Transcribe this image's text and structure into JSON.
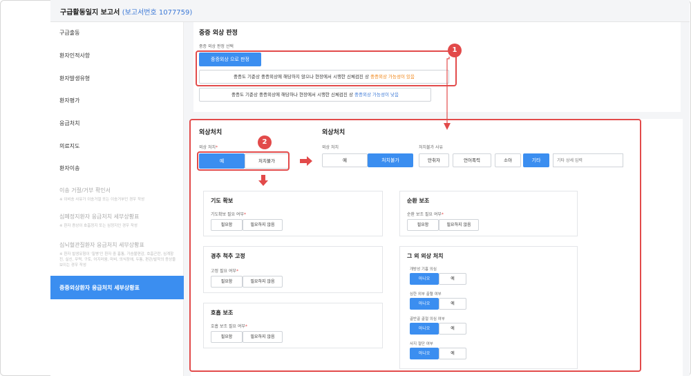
{
  "header": {
    "title": "구급활동일지 보고서",
    "report": "(보고서번호 1077759)"
  },
  "sidebar": {
    "items": [
      {
        "label": "구급출동"
      },
      {
        "label": "환자인적사항"
      },
      {
        "label": "환자발생유형"
      },
      {
        "label": "환자평가"
      },
      {
        "label": "응급처치"
      },
      {
        "label": "의료지도"
      },
      {
        "label": "환자이송"
      },
      {
        "label": "이송 거절/거부 확인서",
        "sub": "※ 이비송 사유가 이송거절 또는 이송거부인 경우 작성"
      },
      {
        "label": "심폐정지환자 응급처치 세부상황표",
        "sub": "※ 환자 증상이 호흡정지 또는 심정지인 경우 작성"
      },
      {
        "label": "심뇌혈관질환자 응급처치 세부상황표",
        "sub": "※ 환자 발생유형이 '질병'인 환자 중 흉통, 가슴불편감, 호흡곤란, 심계항진, 실신, 무력, 구토, 어지러움, 마비, 의식장애, 두통, 편관/발작의 증상을 보이는 경우 작성"
      },
      {
        "label": "중증외상환자 응급처치 세부상황표"
      }
    ]
  },
  "severe": {
    "title": "중증 외상 판정",
    "label": "중증 외상 판정 선택",
    "primary_btn": "중증외상 으로 판정",
    "opt1_prefix": "중증도 기준상 중증외상에 해당하지 않으나 현장에서 시행한 신체검진 상",
    "opt1_highlight": "중증외상 가능성이 있음",
    "opt2_prefix": "중증도 기준상 중증외상에 해당하나 현장에서 시행한 신체검진 상",
    "opt2_highlight": "중증외상 가능성이 낮음"
  },
  "badges": {
    "one": "1",
    "two": "2"
  },
  "trauma_left": {
    "title": "외상처치",
    "label": "외상 처치",
    "req": "*",
    "yes": "예",
    "no": "처치불가"
  },
  "trauma_right": {
    "title": "외상처치",
    "label": "외상 처치",
    "yes": "예",
    "no": "처치불가",
    "reason_label": "처치불가 사유",
    "reasons": [
      "만취자",
      "언어폭력",
      "소아",
      "기타"
    ],
    "detail_placeholder": "기타 상세 입력"
  },
  "cards": {
    "airway": {
      "title": "기도 확보",
      "label": "기도확보 필요 여부",
      "need": "필요함",
      "noneed": "필요하지 않음"
    },
    "spine": {
      "title": "경추 척추 고정",
      "label": "고정 필요 여부",
      "need": "필요함",
      "noneed": "필요하지 않음"
    },
    "breath": {
      "title": "호흡 보조",
      "label": "호흡 보조 필요 여부",
      "need": "필요함",
      "noneed": "필요하지 않음"
    },
    "circ": {
      "title": "순환 보조",
      "label": "순환 보조 필요 여부",
      "need": "필요함",
      "noneed": "필요하지 않음"
    },
    "other": {
      "title": "그 외 외상 처치",
      "rows": [
        {
          "label": "개방성 기흉 의심",
          "no": "아니오",
          "yes": "예"
        },
        {
          "label": "심한 외부 출혈 여부",
          "no": "아니오",
          "yes": "예"
        },
        {
          "label": "골반골 골절 의심 여부",
          "no": "아니오",
          "yes": "예"
        },
        {
          "label": "사지 절단 여부",
          "no": "아니오",
          "yes": "예"
        }
      ]
    }
  },
  "colors": {
    "accent": "#3b8ef0",
    "highlight": "#e24a4a",
    "orange": "#f0810f"
  }
}
